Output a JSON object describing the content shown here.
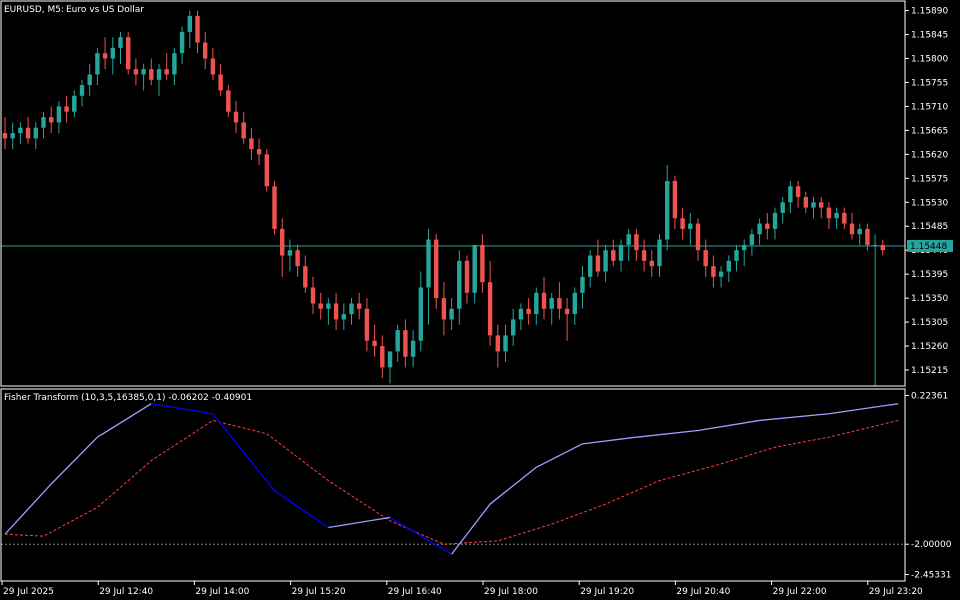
{
  "header": {
    "symbol": "EURUSD, M5:",
    "description": "Euro vs US Dollar"
  },
  "indicator": {
    "label": "Fisher Transform (10,3,5,16385,0,1) -0.06202 -0.40901"
  },
  "colors": {
    "background": "#000000",
    "bull": "#26a69a",
    "bear": "#ef5350",
    "grid_border": "#ffffff",
    "price_line": "#26a69a",
    "fisher_up": "#9f9fff",
    "fisher_down": "#0000ff",
    "signal": "#ff4040",
    "level_line": "#888888"
  },
  "current_price_label": "1.15448",
  "chart_data": [
    {
      "type": "candlestick",
      "title": "EURUSD, M5: Euro vs US Dollar",
      "y_ticks": [
        "1.15890",
        "1.15845",
        "1.15800",
        "1.15755",
        "1.15710",
        "1.15665",
        "1.15620",
        "1.15575",
        "1.15530",
        "1.15485",
        "1.15440",
        "1.15395",
        "1.15350",
        "1.15305",
        "1.15260",
        "1.15215"
      ],
      "ylim": [
        1.15185,
        1.15908
      ],
      "current_price": 1.15448,
      "candles": [
        [
          1.1566,
          1.1569,
          1.1563,
          1.1565
        ],
        [
          1.1565,
          1.1568,
          1.1563,
          1.1566
        ],
        [
          1.1566,
          1.1568,
          1.1564,
          1.1567
        ],
        [
          1.1567,
          1.1569,
          1.1564,
          1.1565
        ],
        [
          1.1565,
          1.1568,
          1.1563,
          1.1567
        ],
        [
          1.1567,
          1.157,
          1.1565,
          1.1569
        ],
        [
          1.1569,
          1.1571,
          1.1566,
          1.1568
        ],
        [
          1.1568,
          1.1572,
          1.1566,
          1.1571
        ],
        [
          1.1571,
          1.1573,
          1.1568,
          1.157
        ],
        [
          1.157,
          1.1574,
          1.1569,
          1.1573
        ],
        [
          1.1573,
          1.1576,
          1.1571,
          1.1575
        ],
        [
          1.1575,
          1.1579,
          1.1573,
          1.1577
        ],
        [
          1.1577,
          1.1582,
          1.1575,
          1.1581
        ],
        [
          1.1581,
          1.1584,
          1.1578,
          1.158
        ],
        [
          1.158,
          1.1584,
          1.1577,
          1.1582
        ],
        [
          1.1582,
          1.1585,
          1.1579,
          1.1584
        ],
        [
          1.1584,
          1.1585,
          1.1577,
          1.1578
        ],
        [
          1.1578,
          1.158,
          1.1575,
          1.1577
        ],
        [
          1.1577,
          1.1579,
          1.1574,
          1.1578
        ],
        [
          1.1578,
          1.158,
          1.1575,
          1.1576
        ],
        [
          1.1576,
          1.1579,
          1.1573,
          1.1578
        ],
        [
          1.1578,
          1.1581,
          1.1576,
          1.1577
        ],
        [
          1.1577,
          1.1582,
          1.1575,
          1.1581
        ],
        [
          1.1581,
          1.1586,
          1.1579,
          1.1585
        ],
        [
          1.1585,
          1.1589,
          1.1582,
          1.1588
        ],
        [
          1.1588,
          1.1589,
          1.1581,
          1.1583
        ],
        [
          1.1583,
          1.1585,
          1.1578,
          1.158
        ],
        [
          1.158,
          1.1582,
          1.1576,
          1.1577
        ],
        [
          1.1577,
          1.1579,
          1.1573,
          1.1574
        ],
        [
          1.1574,
          1.1575,
          1.1569,
          1.157
        ],
        [
          1.157,
          1.1572,
          1.1566,
          1.1568
        ],
        [
          1.1568,
          1.157,
          1.1564,
          1.1565
        ],
        [
          1.1565,
          1.1567,
          1.1561,
          1.1563
        ],
        [
          1.1563,
          1.1565,
          1.156,
          1.1562
        ],
        [
          1.1562,
          1.1563,
          1.1555,
          1.1556
        ],
        [
          1.1556,
          1.1557,
          1.1547,
          1.1548
        ],
        [
          1.1548,
          1.155,
          1.1539,
          1.1543
        ],
        [
          1.1543,
          1.1546,
          1.154,
          1.1544
        ],
        [
          1.1544,
          1.1545,
          1.1539,
          1.1541
        ],
        [
          1.1541,
          1.1543,
          1.1536,
          1.1537
        ],
        [
          1.1537,
          1.1539,
          1.1532,
          1.1534
        ],
        [
          1.1534,
          1.1536,
          1.1531,
          1.1533
        ],
        [
          1.1533,
          1.1535,
          1.153,
          1.1534
        ],
        [
          1.1534,
          1.1536,
          1.1529,
          1.1531
        ],
        [
          1.1531,
          1.1534,
          1.1529,
          1.1532
        ],
        [
          1.1532,
          1.1535,
          1.153,
          1.1534
        ],
        [
          1.1534,
          1.1536,
          1.1531,
          1.1533
        ],
        [
          1.1533,
          1.1535,
          1.1525,
          1.1527
        ],
        [
          1.1527,
          1.153,
          1.1524,
          1.1526
        ],
        [
          1.1526,
          1.1528,
          1.152,
          1.1522
        ],
        [
          1.1522,
          1.1524,
          1.1519,
          1.1525
        ],
        [
          1.1525,
          1.153,
          1.1523,
          1.1529
        ],
        [
          1.1529,
          1.1531,
          1.1522,
          1.1524
        ],
        [
          1.1524,
          1.1529,
          1.1522,
          1.1527
        ],
        [
          1.1527,
          1.154,
          1.1525,
          1.1537
        ],
        [
          1.1537,
          1.1548,
          1.153,
          1.1546
        ],
        [
          1.1546,
          1.1547,
          1.1533,
          1.1535
        ],
        [
          1.1535,
          1.1538,
          1.1528,
          1.1531
        ],
        [
          1.1531,
          1.1535,
          1.1529,
          1.1533
        ],
        [
          1.1533,
          1.1544,
          1.153,
          1.1542
        ],
        [
          1.1542,
          1.1543,
          1.1534,
          1.1536
        ],
        [
          1.1536,
          1.1544,
          1.1534,
          1.1545
        ],
        [
          1.1545,
          1.1547,
          1.1536,
          1.1538
        ],
        [
          1.1538,
          1.1542,
          1.1526,
          1.1528
        ],
        [
          1.1528,
          1.153,
          1.1522,
          1.1525
        ],
        [
          1.1525,
          1.153,
          1.1523,
          1.1528
        ],
        [
          1.1528,
          1.1533,
          1.1526,
          1.1531
        ],
        [
          1.1531,
          1.1534,
          1.1529,
          1.1533
        ],
        [
          1.1533,
          1.1535,
          1.153,
          1.1532
        ],
        [
          1.1532,
          1.1537,
          1.153,
          1.1536
        ],
        [
          1.1536,
          1.1539,
          1.1531,
          1.1533
        ],
        [
          1.1533,
          1.1536,
          1.153,
          1.1535
        ],
        [
          1.1535,
          1.1538,
          1.1531,
          1.1533
        ],
        [
          1.1533,
          1.1535,
          1.1527,
          1.1532
        ],
        [
          1.1532,
          1.1537,
          1.153,
          1.1536
        ],
        [
          1.1536,
          1.1541,
          1.1533,
          1.1539
        ],
        [
          1.1539,
          1.1544,
          1.1537,
          1.1543
        ],
        [
          1.1543,
          1.1546,
          1.1539,
          1.154
        ],
        [
          1.154,
          1.1545,
          1.1538,
          1.1544
        ],
        [
          1.1544,
          1.1546,
          1.1541,
          1.1542
        ],
        [
          1.1542,
          1.1546,
          1.154,
          1.1545
        ],
        [
          1.1545,
          1.1548,
          1.1542,
          1.1547
        ],
        [
          1.1547,
          1.1548,
          1.1542,
          1.1544
        ],
        [
          1.1544,
          1.1546,
          1.154,
          1.1542
        ],
        [
          1.1542,
          1.1544,
          1.1539,
          1.1541
        ],
        [
          1.1541,
          1.1547,
          1.1539,
          1.1546
        ],
        [
          1.1546,
          1.156,
          1.1544,
          1.1557
        ],
        [
          1.1557,
          1.1558,
          1.1548,
          1.155
        ],
        [
          1.155,
          1.1552,
          1.1546,
          1.1548
        ],
        [
          1.1548,
          1.1551,
          1.1545,
          1.1549
        ],
        [
          1.1549,
          1.155,
          1.1542,
          1.1544
        ],
        [
          1.1544,
          1.1546,
          1.1539,
          1.1541
        ],
        [
          1.1541,
          1.1543,
          1.1537,
          1.1539
        ],
        [
          1.1539,
          1.1541,
          1.1537,
          1.154
        ],
        [
          1.154,
          1.1543,
          1.1538,
          1.1542
        ],
        [
          1.1542,
          1.1545,
          1.154,
          1.1544
        ],
        [
          1.1544,
          1.1546,
          1.1541,
          1.1545
        ],
        [
          1.1545,
          1.1548,
          1.1543,
          1.1547
        ],
        [
          1.1547,
          1.155,
          1.1545,
          1.1549
        ],
        [
          1.1549,
          1.1551,
          1.1546,
          1.1548
        ],
        [
          1.1548,
          1.1552,
          1.1546,
          1.1551
        ],
        [
          1.1551,
          1.1554,
          1.1549,
          1.1553
        ],
        [
          1.1553,
          1.1557,
          1.1551,
          1.1556
        ],
        [
          1.1556,
          1.1557,
          1.1552,
          1.1554
        ],
        [
          1.1554,
          1.1555,
          1.1551,
          1.1552
        ],
        [
          1.1552,
          1.1554,
          1.155,
          1.1553
        ],
        [
          1.1553,
          1.1554,
          1.155,
          1.1552
        ],
        [
          1.1552,
          1.1553,
          1.1548,
          1.155
        ],
        [
          1.155,
          1.1552,
          1.1548,
          1.1551
        ],
        [
          1.1551,
          1.1552,
          1.1548,
          1.1549
        ],
        [
          1.1549,
          1.1551,
          1.1546,
          1.1547
        ],
        [
          1.1547,
          1.1549,
          1.1545,
          1.1548
        ],
        [
          1.1548,
          1.1549,
          1.1544,
          1.1545
        ],
        [
          1.1545,
          1.1547,
          1.1443,
          1.1545
        ],
        [
          1.1545,
          1.1546,
          1.1543,
          1.1544
        ]
      ]
    },
    {
      "type": "line",
      "title": "Fisher Transform (10,3,5,16385,0,1) -0.06202 -0.40901",
      "y_ticks": [
        "0.22361",
        "-2.00000",
        "-2.45331"
      ],
      "ylim": [
        -2.55,
        0.32
      ],
      "levels": [
        -2.0
      ],
      "x_tick_labels": [
        "29 Jul 2025",
        "29 Jul 12:40",
        "29 Jul 14:00",
        "29 Jul 15:20",
        "29 Jul 16:40",
        "29 Jul 18:00",
        "29 Jul 19:20",
        "29 Jul 20:40",
        "29 Jul 22:00",
        "29 Jul 23:20"
      ],
      "series": [
        {
          "role": "fisher",
          "x": [
            0,
            6,
            12,
            19,
            27,
            35,
            42,
            50,
            58,
            63,
            69,
            75,
            82,
            90,
            98,
            107,
            116
          ],
          "values": [
            -1.85,
            -1.1,
            -0.4,
            0.1,
            -0.05,
            -1.2,
            -1.75,
            -1.6,
            -2.15,
            -1.4,
            -0.85,
            -0.5,
            -0.4,
            -0.3,
            -0.15,
            -0.05,
            0.1
          ]
        },
        {
          "role": "signal",
          "x": [
            0,
            5,
            12,
            19,
            27,
            34,
            42,
            50,
            57,
            64,
            71,
            78,
            85,
            93,
            100,
            107,
            116
          ],
          "values": [
            -1.85,
            -1.88,
            -1.45,
            -0.75,
            -0.15,
            -0.35,
            -1.05,
            -1.65,
            -2.0,
            -1.95,
            -1.7,
            -1.4,
            -1.05,
            -0.8,
            -0.55,
            -0.4,
            -0.15
          ]
        }
      ]
    }
  ]
}
